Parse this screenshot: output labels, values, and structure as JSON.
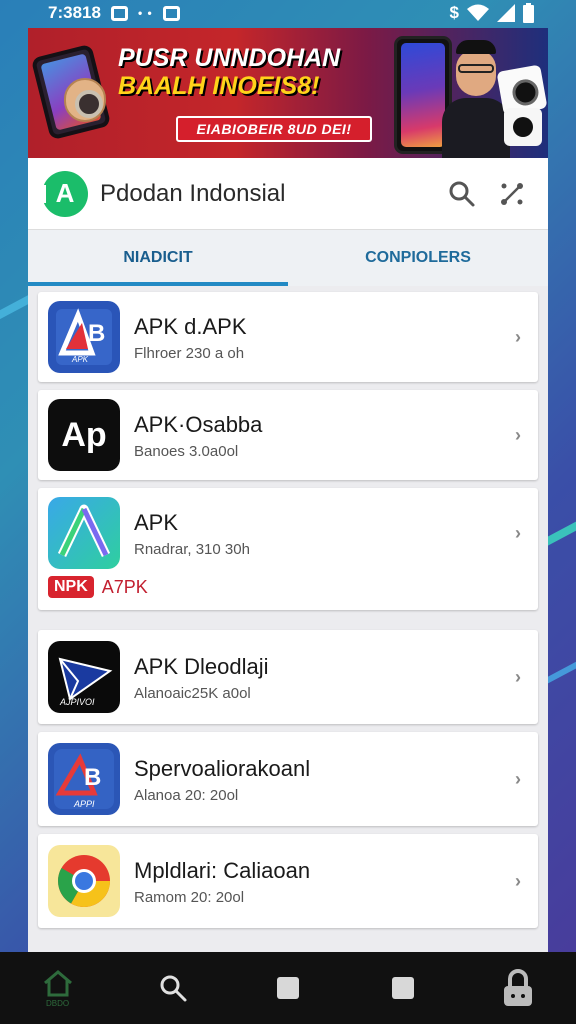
{
  "status_bar": {
    "time": "7:3818"
  },
  "banner": {
    "title_line1": "PUSR UNNDOHAN",
    "title_line2": "BAALH INOEIS8!",
    "pill": "EIABIOBEIR 8UD DEI!"
  },
  "header": {
    "title": "Pdodan Indonsial",
    "logo_letter": "A"
  },
  "tabs": [
    {
      "label": "NIADICIT"
    },
    {
      "label": "CONPIOLERS"
    }
  ],
  "apps": [
    {
      "name": "APK d.APK",
      "sub": "Flhroer 230 a oh",
      "icon": "ab-apk-icon",
      "icon_caption": "APK"
    },
    {
      "name": "APK·Osabba",
      "sub": "Banoes 3.0a0ol",
      "icon": "ap-icon",
      "icon_text": "Ap"
    },
    {
      "name": "APK",
      "sub": "Rnadrar, 310 30h",
      "icon": "a-gradient-icon",
      "tag_badge": "NPK",
      "tag_text": "A7PK"
    },
    {
      "name": "APK Dleodlaji",
      "sub": "Alanoaic25K a0ol",
      "icon": "paper-plane-icon",
      "icon_caption": "AJPIVOI"
    },
    {
      "name": "Spervoaliorakoanl",
      "sub": "Alanoa 20: 20ol",
      "icon": "ab-red-icon",
      "icon_caption": "APPI"
    },
    {
      "name": "Mpldlari: Caliaoan",
      "sub": "Ramom 20: 20ol",
      "icon": "chrome-icon"
    }
  ],
  "nav": {
    "home_label": "DBDO"
  },
  "colors": {
    "accent": "#238ac4",
    "brand_green": "#1bbd6a",
    "banner_red": "#c4262a",
    "tag_red": "#d8242e"
  }
}
